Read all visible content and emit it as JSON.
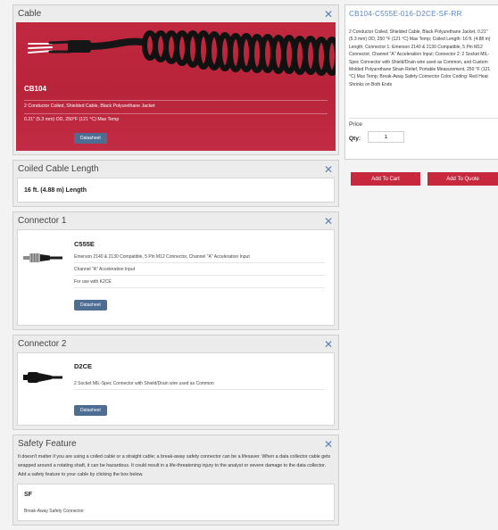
{
  "cable": {
    "title": "Cable",
    "code": "CB104",
    "line1": "2 Conductor Coiled, Shielded Cable, Black Polyurethane Jacket",
    "line2": "0.21\" (5.3 mm) OD, 250°F (121 °C) Max Temp",
    "datasheet": "Datasheet"
  },
  "coiled": {
    "title": "Coiled Cable Length",
    "value": "16 ft. (4.88 m) Length"
  },
  "connector1": {
    "title": "Connector 1",
    "code": "C555E",
    "line1": "Emerson 2140 & 2130 Compatible, 5 Pin M12 Connector, Channel \"A\" Acceleration Input",
    "line2": "Channel \"A\" Acceleration Input",
    "line3": "For use with K2CE",
    "datasheet": "Datasheet"
  },
  "connector2": {
    "title": "Connector 2",
    "code": "D2CE",
    "line1": "2 Socket MIL-Spec Connector with Shield/Drain wire used as Common",
    "datasheet": "Datasheet"
  },
  "safety": {
    "title": "Safety Feature",
    "description": "It doesn't matter if you are using a coiled cable or a straight cable; a break-away safety connector can be a lifesaver. When a data collector cable gets wrapped around a rotating shaft, it can be hazardous. It could result in a life-threatening injury to the analyst or severe damage to the data collector. Add a safety feature to your cable by clicking the box below.",
    "code": "SF",
    "line1": "Break-Away Safety Connector"
  },
  "summary": {
    "part_number": "CB104-C555E-016-D2CE-SF-RR",
    "description": "2 Conductor Coiled, Shielded Cable, Black Polyurethane Jacket, 0.21\" (5.3 mm) OD, 250 °F (121 °C) Max Temp; Coiled Length: 16 ft. (4.88 m) Length; Connector 1: Emerson 2140 & 2130 Compatible, 5 Pin M12 Connector, Channel \"A\" Acceleration Input; Connector 2: 2 Socket MIL-Spec Connector with Shield/Drain wire used as Common, and Custom Molded Polyurethane Strain Relief, Portable Measurement, 250 °F (121 °C) Max Temp; Break-Away Safety Connector Color Coding: Red Heat Shrinks on Both Ends",
    "price_label": "Price",
    "qty_label": "Qty:",
    "qty_value": "1"
  },
  "actions": {
    "add_to_cart": "Add To Cart",
    "add_to_quote": "Add To Quote"
  },
  "close_glyph": "✕",
  "colors": {
    "accent_red": "#c8283d",
    "link_blue": "#5a86c4",
    "button_slate": "#4d6d92"
  }
}
